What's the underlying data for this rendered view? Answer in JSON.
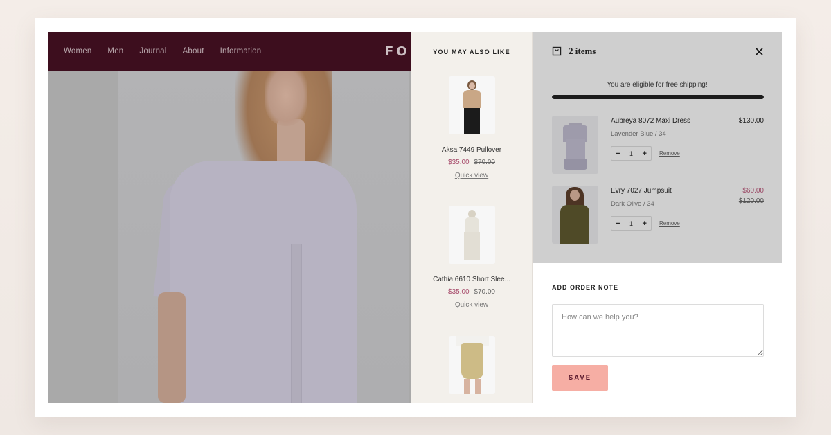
{
  "site": {
    "nav": [
      "Women",
      "Men",
      "Journal",
      "About",
      "Information"
    ],
    "logo": "FO",
    "header_color": "#3d0e1e"
  },
  "recommendations": {
    "title": "YOU MAY ALSO LIKE",
    "items": [
      {
        "name": "Aksa 7449 Pullover",
        "sale_price": "$35.00",
        "original_price": "$70.00",
        "quick_view": "Quick view"
      },
      {
        "name": "Cathia 6610 Short Slee...",
        "sale_price": "$35.00",
        "original_price": "$70.00",
        "quick_view": "Quick view"
      },
      {
        "name": "",
        "sale_price": "",
        "original_price": "",
        "quick_view": ""
      }
    ]
  },
  "cart": {
    "count_label": "2 items",
    "shipping_message": "You are eligible for free shipping!",
    "shipping_progress": 1.0,
    "items": [
      {
        "name": "Aubreya 8072 Maxi Dress",
        "variant": "Lavender Blue / 34",
        "price": "$130.00",
        "original_price": "",
        "quantity": "1",
        "remove_label": "Remove"
      },
      {
        "name": "Evry 7027 Jumpsuit",
        "variant": "Dark Olive / 34",
        "price": "$60.00",
        "original_price": "$120.00",
        "quantity": "1",
        "remove_label": "Remove"
      }
    ],
    "note": {
      "label": "ADD ORDER NOTE",
      "placeholder": "How can we help you?",
      "value": ""
    },
    "save_label": "SAVE",
    "accent_color": "#f6aea4",
    "sale_color": "#a64a6a"
  }
}
